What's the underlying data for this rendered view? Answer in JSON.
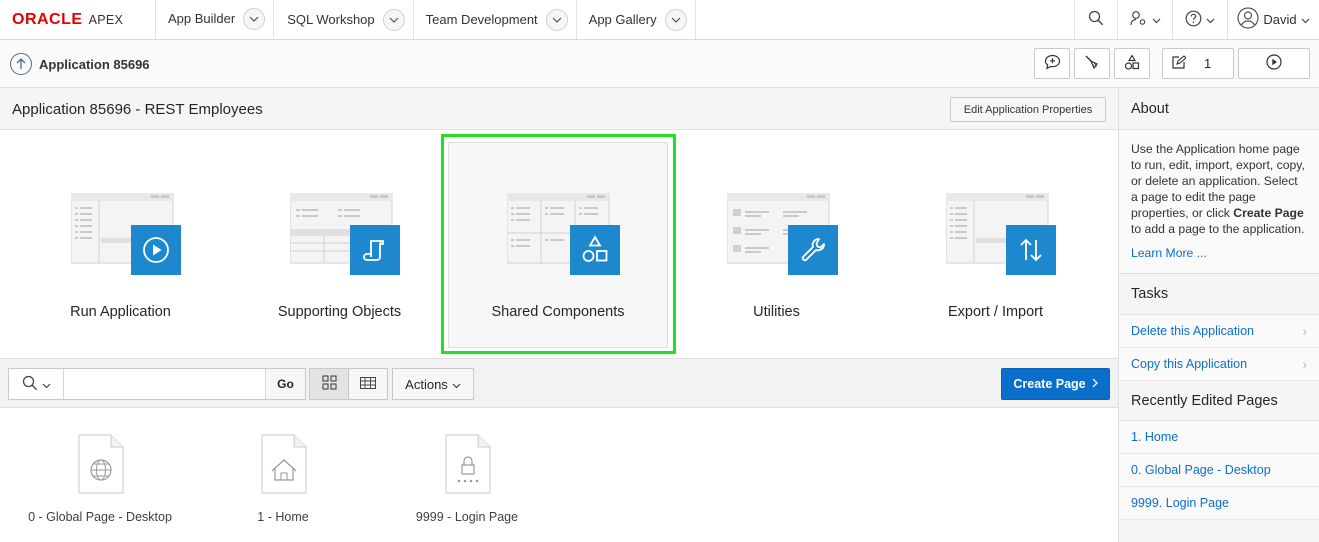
{
  "topbar": {
    "brand": "ORACLE",
    "product": "APEX",
    "tabs": [
      {
        "label": "App Builder"
      },
      {
        "label": "SQL Workshop"
      },
      {
        "label": "Team Development"
      },
      {
        "label": "App Gallery"
      }
    ],
    "user": "David"
  },
  "subbar": {
    "title": "Application 85696",
    "edit_count": "1"
  },
  "region": {
    "title": "Application 85696 - REST Employees",
    "edit_props_label": "Edit Application Properties"
  },
  "tiles": [
    {
      "label": "Run Application",
      "icon": "play-icon"
    },
    {
      "label": "Supporting Objects",
      "icon": "scroll-icon"
    },
    {
      "label": "Shared Components",
      "icon": "shapes-icon"
    },
    {
      "label": "Utilities",
      "icon": "wrench-icon"
    },
    {
      "label": "Export / Import",
      "icon": "transfer-icon"
    }
  ],
  "search": {
    "value": "",
    "go_label": "Go",
    "actions_label": "Actions",
    "create_label": "Create Page"
  },
  "pages": [
    {
      "label": "0 - Global Page - Desktop",
      "icon": "globe-icon"
    },
    {
      "label": "1 - Home",
      "icon": "house-icon"
    },
    {
      "label": "9999 - Login Page",
      "icon": "lock-icon"
    }
  ],
  "sidebar": {
    "about_title": "About",
    "about_text_1": "Use the Application home page to run, edit, import, export, copy, or delete an application. Select a page to edit the page properties, or click ",
    "about_bold": "Create Page",
    "about_text_2": " to add a page to the application.",
    "learn_more": "Learn More ...",
    "tasks_title": "Tasks",
    "tasks": [
      "Delete this Application",
      "Copy this Application"
    ],
    "recent_title": "Recently Edited Pages",
    "recent": [
      "1. Home",
      "0. Global Page - Desktop",
      "9999. Login Page"
    ]
  },
  "colors": {
    "accent": "#0a6fcb",
    "tile_icon": "#1e88cf",
    "highlight": "#1ee31e",
    "oracle_red": "#e60000"
  }
}
